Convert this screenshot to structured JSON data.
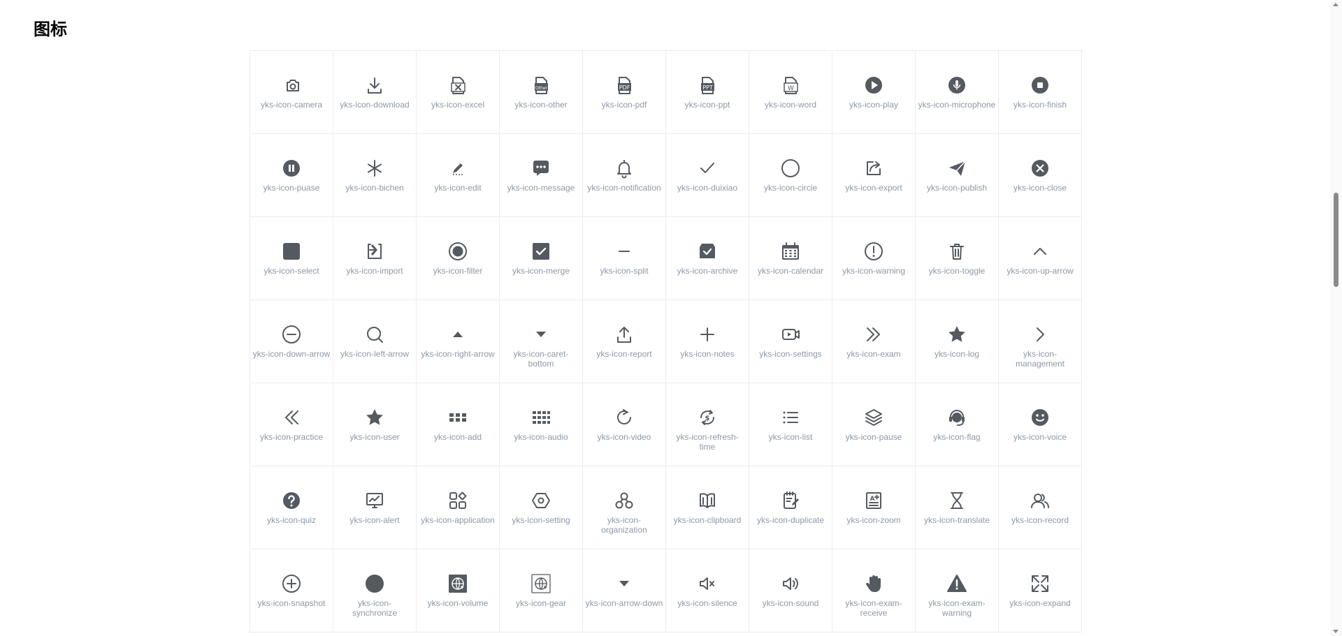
{
  "page": {
    "title": "图标"
  },
  "colors": {
    "icon": "#555a60",
    "label": "#8e98a6",
    "border": "#ececec"
  },
  "icons": [
    {
      "label": "yks-icon-camera",
      "icon": "camera"
    },
    {
      "label": "yks-icon-download",
      "icon": "download"
    },
    {
      "label": "yks-icon-excel",
      "icon": "file-x"
    },
    {
      "label": "yks-icon-other",
      "icon": "file-other"
    },
    {
      "label": "yks-icon-pdf",
      "icon": "file-pdf"
    },
    {
      "label": "yks-icon-ppt",
      "icon": "file-ppt"
    },
    {
      "label": "yks-icon-word",
      "icon": "file-w"
    },
    {
      "label": "yks-icon-play",
      "icon": "play-circle"
    },
    {
      "label": "yks-icon-microphone",
      "icon": "mic-circle"
    },
    {
      "label": "yks-icon-finish",
      "icon": "stop-circle"
    },
    {
      "label": "yks-icon-puase",
      "icon": "pause-circle"
    },
    {
      "label": "yks-icon-bichen",
      "icon": "asterisk"
    },
    {
      "label": "yks-icon-edit",
      "icon": "pencil"
    },
    {
      "label": "yks-icon-message",
      "icon": "chat-bubble"
    },
    {
      "label": "yks-icon-notification",
      "icon": "bell"
    },
    {
      "label": "yks-icon-duixiao",
      "icon": "check"
    },
    {
      "label": "yks-icon-circle",
      "icon": "circle-outline"
    },
    {
      "label": "yks-icon-export",
      "icon": "share-box"
    },
    {
      "label": "yks-icon-publish",
      "icon": "paper-plane"
    },
    {
      "label": "yks-icon-close",
      "icon": "close-circle"
    },
    {
      "label": "yks-icon-select",
      "icon": "square-filled"
    },
    {
      "label": "yks-icon-import",
      "icon": "import-box"
    },
    {
      "label": "yks-icon-filter",
      "icon": "radio-dot"
    },
    {
      "label": "yks-icon-merge",
      "icon": "checkbox-filled"
    },
    {
      "label": "yks-icon-split",
      "icon": "minus"
    },
    {
      "label": "yks-icon-archive",
      "icon": "archive-box"
    },
    {
      "label": "yks-icon-calendar",
      "icon": "calendar"
    },
    {
      "label": "yks-icon-warning",
      "icon": "exclaim-circle"
    },
    {
      "label": "yks-icon-toggle",
      "icon": "trash"
    },
    {
      "label": "yks-icon-up-arrow",
      "icon": "chevron-up"
    },
    {
      "label": "yks-icon-down-arrow",
      "icon": "minus-circle"
    },
    {
      "label": "yks-icon-left-arrow",
      "icon": "magnifier"
    },
    {
      "label": "yks-icon-right-arrow",
      "icon": "caret-up"
    },
    {
      "label": "yks-icon-caret-bottom",
      "icon": "caret-down"
    },
    {
      "label": "yks-icon-report",
      "icon": "upload"
    },
    {
      "label": "yks-icon-notes",
      "icon": "plus"
    },
    {
      "label": "yks-icon-settings",
      "icon": "video-box"
    },
    {
      "label": "yks-icon-exam",
      "icon": "double-chevron-right"
    },
    {
      "label": "yks-icon-log",
      "icon": "star"
    },
    {
      "label": "yks-icon-management",
      "icon": "chevron-right"
    },
    {
      "label": "yks-icon-practice",
      "icon": "double-chevron-left"
    },
    {
      "label": "yks-icon-user",
      "icon": "star"
    },
    {
      "label": "yks-icon-add",
      "icon": "grid-2x3"
    },
    {
      "label": "yks-icon-audio",
      "icon": "grid-3x4"
    },
    {
      "label": "yks-icon-video",
      "icon": "refresh"
    },
    {
      "label": "yks-icon-refresh-time",
      "icon": "refresh-dollar"
    },
    {
      "label": "yks-icon-list",
      "icon": "list"
    },
    {
      "label": "yks-icon-pause",
      "icon": "layers"
    },
    {
      "label": "yks-icon-flag",
      "icon": "headset"
    },
    {
      "label": "yks-icon-voice",
      "icon": "smile"
    },
    {
      "label": "yks-icon-quiz",
      "icon": "question-circle"
    },
    {
      "label": "yks-icon-alert",
      "icon": "monitor-chart"
    },
    {
      "label": "yks-icon-application",
      "icon": "apps"
    },
    {
      "label": "yks-icon-setting",
      "icon": "hexagon"
    },
    {
      "label": "yks-icon-organization",
      "icon": "org-nodes"
    },
    {
      "label": "yks-icon-clipboard",
      "icon": "book-open"
    },
    {
      "label": "yks-icon-duplicate",
      "icon": "notepad"
    },
    {
      "label": "yks-icon-zoom",
      "icon": "text-doc"
    },
    {
      "label": "yks-icon-translate",
      "icon": "hourglass"
    },
    {
      "label": "yks-icon-record",
      "icon": "users"
    },
    {
      "label": "yks-icon-snapshot",
      "icon": "plus-circle"
    },
    {
      "label": "yks-icon-synchronize",
      "icon": "circle-filled"
    },
    {
      "label": "yks-icon-volume",
      "icon": "globe-dark"
    },
    {
      "label": "yks-icon-gear",
      "icon": "globe-light"
    },
    {
      "label": "yks-icon-arrow-down",
      "icon": "caret-down"
    },
    {
      "label": "yks-icon-silence",
      "icon": "speaker-mute"
    },
    {
      "label": "yks-icon-sound",
      "icon": "speaker-sound"
    },
    {
      "label": "yks-icon-exam-receive",
      "icon": "hand"
    },
    {
      "label": "yks-icon-exam-warning",
      "icon": "warning-triangle"
    },
    {
      "label": "yks-icon-expand",
      "icon": "expand"
    }
  ]
}
